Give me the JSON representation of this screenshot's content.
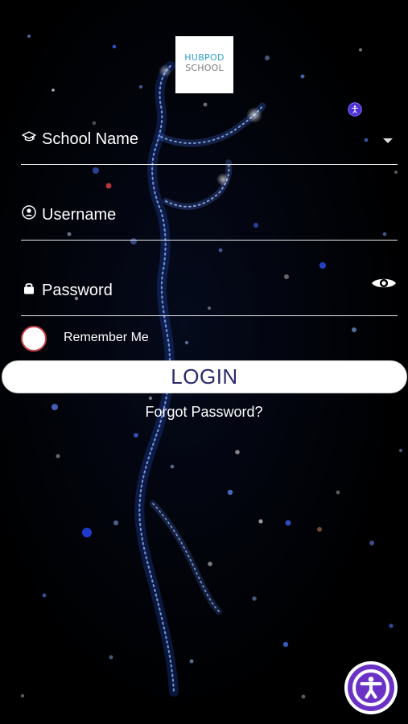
{
  "logo": {
    "line1": "HUBPOD",
    "line2": "SCHOOL"
  },
  "form": {
    "school_name_placeholder": "School Name",
    "username_placeholder": "Username",
    "password_placeholder": "Password",
    "remember_me_label": "Remember Me",
    "remember_me_checked": false,
    "login_label": "LOGIN",
    "forgot_password_label": "Forgot Password?"
  },
  "icons": {
    "school": "school-cap-icon",
    "user": "user-circle-icon",
    "password": "lock-icon",
    "dropdown": "chevron-down-icon",
    "show_password": "eye-icon",
    "accessibility": "accessibility-icon"
  },
  "colors": {
    "background": "#000000",
    "login_text": "#2a2a6e",
    "accessibility": "#6b33c5",
    "remember_border": "#c8404a",
    "logo_blue": "#2f9fd0",
    "logo_gray": "#7b7b7b"
  }
}
